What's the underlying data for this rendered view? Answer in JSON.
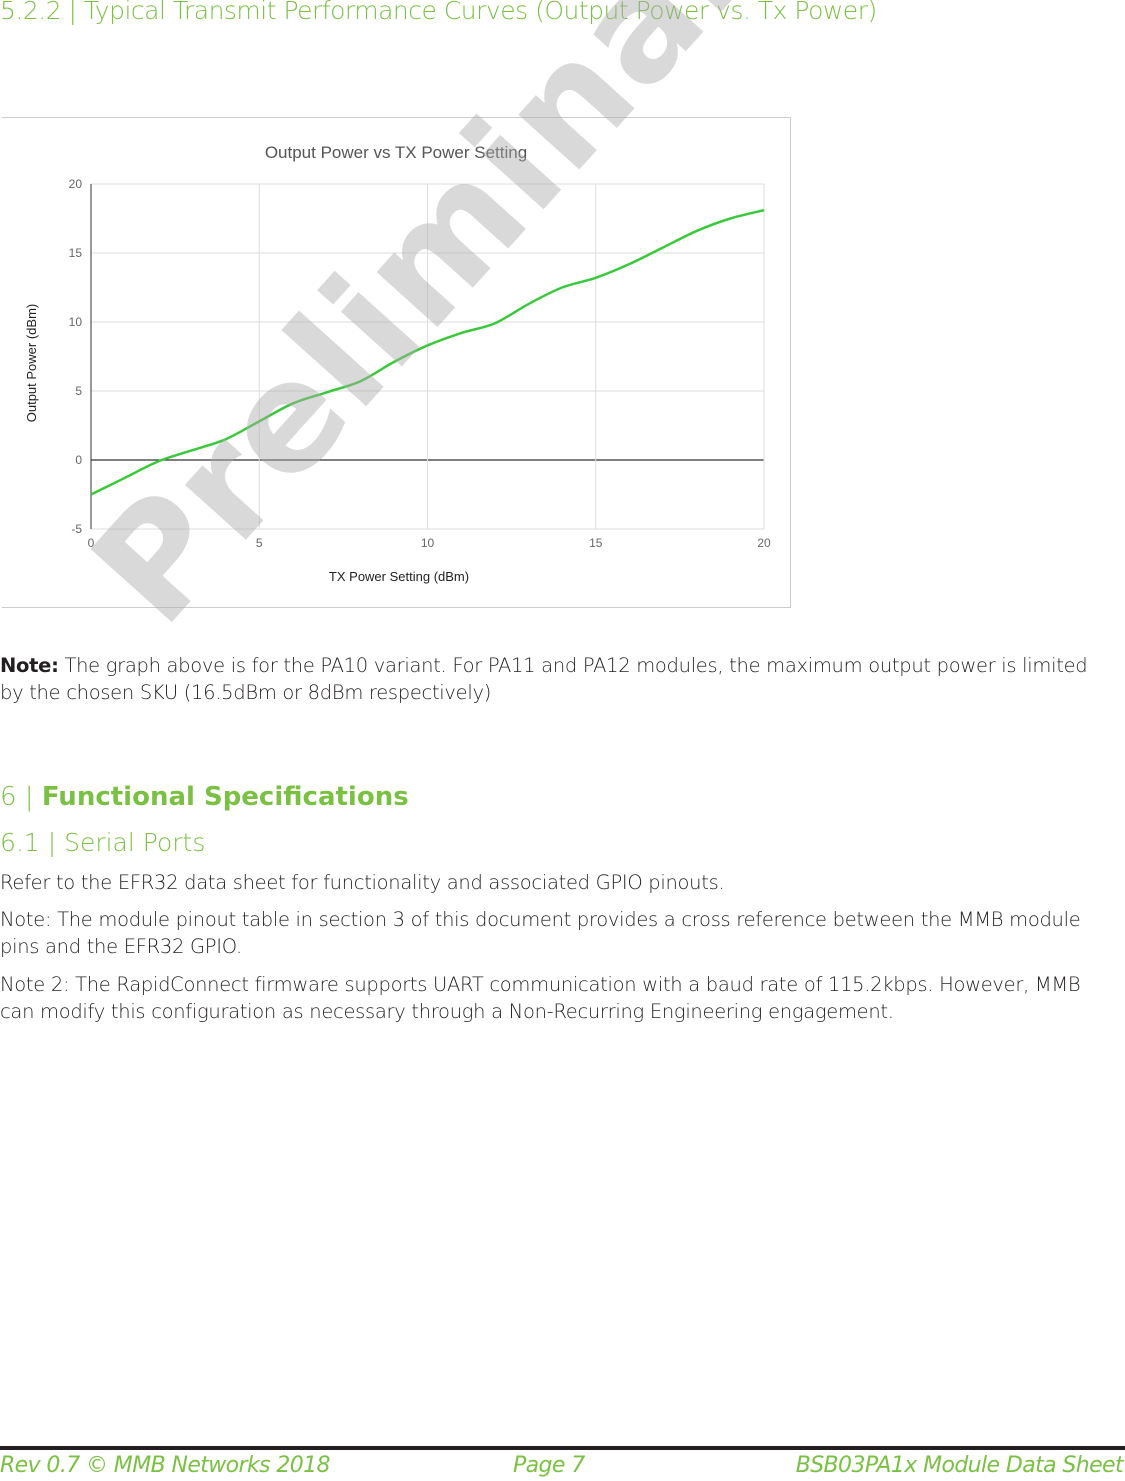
{
  "section_heading": "5.2.2 | Typical Transmit Performance Curves (Output Power vs. Tx Power)",
  "chart_data": {
    "type": "line",
    "title": "Output Power vs TX Power Setting",
    "xlabel": "TX Power Setting (dBm)",
    "ylabel": "Output Power (dBm)",
    "xlim": [
      0,
      20
    ],
    "ylim": [
      -5,
      20
    ],
    "xticks": [
      0,
      5,
      10,
      15,
      20
    ],
    "yticks": [
      -5,
      0,
      5,
      10,
      15,
      20
    ],
    "grid": true,
    "legend": "none",
    "line_color": "#3cc83c",
    "x": [
      0,
      1,
      2,
      3,
      4,
      5,
      6,
      7,
      8,
      9,
      10,
      11,
      12,
      13,
      14,
      15,
      16,
      17,
      18,
      19,
      20
    ],
    "y": [
      -2.5,
      -1.3,
      -0.1,
      0.7,
      1.5,
      2.8,
      4.1,
      4.9,
      5.7,
      7.1,
      8.3,
      9.2,
      9.9,
      11.3,
      12.5,
      13.2,
      14.2,
      15.4,
      16.6,
      17.5,
      18.1
    ]
  },
  "note1": {
    "label": "Note:",
    "text": " The graph above is for the PA10 variant. For PA11 and PA12 modules, the maximum output power is limited by the chosen SKU (16.5dBm or 8dBm respectively)"
  },
  "section6": {
    "number": "6 | ",
    "title": "Functional Specifications"
  },
  "section61": "6.1 | Serial Ports",
  "para1": "Refer to the EFR32 data sheet for functionality and associated GPIO pinouts.",
  "para2": "Note:  The module pinout table in section 3 of this document provides a cross reference between the MMB module pins and the EFR32 GPIO.",
  "para3": "Note 2: The RapidConnect firmware supports UART communication with a baud rate of 115.2kbps. However, MMB can modify this configuration as necessary through a Non-Recurring Engineering engagement.",
  "watermark": "Preliminary Information",
  "footer": {
    "left": "Rev 0.7 © MMB Networks 2018",
    "center": "Page 7",
    "right": "BSB03PA1x Module Data Sheet"
  }
}
